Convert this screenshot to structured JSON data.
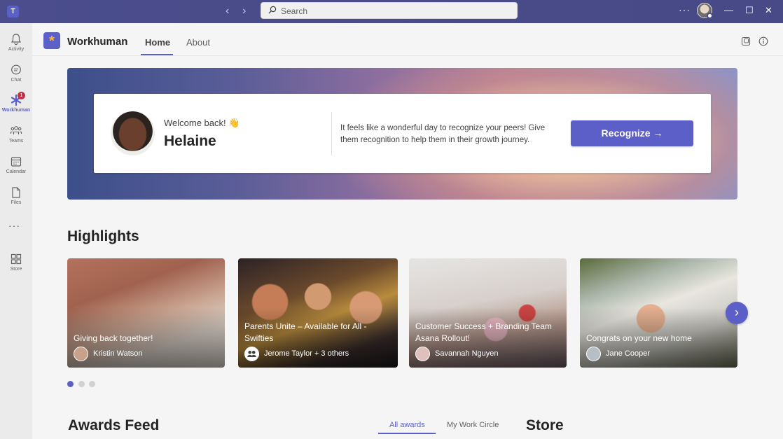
{
  "titlebar": {
    "logo_letter": "T",
    "search_placeholder": "Search",
    "more": "···"
  },
  "rail": {
    "items": [
      {
        "label": "Activity"
      },
      {
        "label": "Chat"
      },
      {
        "label": "Workhuman",
        "badge": "1"
      },
      {
        "label": "Teams"
      },
      {
        "label": "Calendar"
      },
      {
        "label": "Files"
      },
      {
        "label": "Store"
      }
    ],
    "more": "···"
  },
  "app": {
    "name": "Workhuman",
    "logo": "*",
    "tabs": [
      "Home",
      "About"
    ]
  },
  "hero": {
    "welcome": "Welcome back! 👋",
    "name": "Helaine",
    "message": "It feels like a wonderful day to recognize your peers! Give them recognition to help them in their growth journey.",
    "button": "Recognize →"
  },
  "highlights": {
    "title": "Highlights",
    "cards": [
      {
        "title": "Giving back together!",
        "person": "Kristin Watson"
      },
      {
        "title": "Parents Unite – Available for All - Swifties",
        "person": "Jerome Taylor + 3 others"
      },
      {
        "title": "Customer Success + Branding Team Asana Rollout!",
        "person": "Savannah Nguyen"
      },
      {
        "title": "Congrats on your new home",
        "person": "Jane Cooper"
      }
    ],
    "next": "›"
  },
  "feed": {
    "title": "Awards Feed",
    "tabs": [
      "All awards",
      "My Work Circle"
    ],
    "store_title": "Store"
  },
  "colors": {
    "accent": "#5b5fc7",
    "titlebar": "#4b4d8c",
    "badge": "#c4314b"
  }
}
